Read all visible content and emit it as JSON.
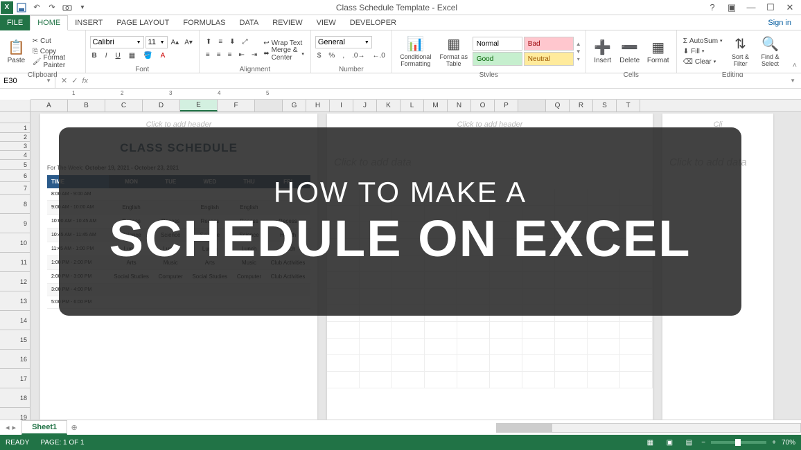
{
  "window": {
    "title": "Class Schedule Template - Excel",
    "help": "?",
    "signin": "Sign in"
  },
  "tabs": {
    "file": "FILE",
    "home": "HOME",
    "insert": "INSERT",
    "page_layout": "PAGE LAYOUT",
    "formulas": "FORMULAS",
    "data": "DATA",
    "review": "REVIEW",
    "view": "VIEW",
    "developer": "DEVELOPER"
  },
  "ribbon": {
    "clipboard": {
      "paste": "Paste",
      "cut": "Cut",
      "copy": "Copy",
      "painter": "Format Painter",
      "label": "Clipboard"
    },
    "font": {
      "name": "Calibri",
      "size": "11",
      "label": "Font"
    },
    "alignment": {
      "wrap": "Wrap Text",
      "merge": "Merge & Center",
      "label": "Alignment"
    },
    "number": {
      "format": "General",
      "label": "Number"
    },
    "styles": {
      "cond": "Conditional Formatting",
      "table": "Format as Table",
      "normal": "Normal",
      "bad": "Bad",
      "good": "Good",
      "neutral": "Neutral",
      "label": "Styles"
    },
    "cells": {
      "insert": "Insert",
      "delete": "Delete",
      "format": "Format",
      "label": "Cells"
    },
    "editing": {
      "autosum": "AutoSum",
      "fill": "Fill",
      "clear": "Clear",
      "sort": "Sort & Filter",
      "find": "Find & Select",
      "label": "Editing"
    }
  },
  "namebox": "E30",
  "columns": [
    "A",
    "B",
    "C",
    "D",
    "E",
    "F",
    "",
    "G",
    "H",
    "I",
    "J",
    "K",
    "L",
    "M",
    "N",
    "O",
    "P",
    "",
    "Q",
    "R",
    "S",
    "T"
  ],
  "rows": [
    "1",
    "2",
    "3",
    "4",
    "5",
    "6",
    "7",
    "8",
    "9",
    "10",
    "11",
    "12",
    "13",
    "14",
    "15",
    "16",
    "17",
    "18",
    "19"
  ],
  "ruler_marks": [
    "1",
    "2",
    "3",
    "4",
    "5"
  ],
  "schedule": {
    "title": "CLASS SCHEDULE",
    "week_label": "For The Week:",
    "week_value": "October 19, 2021 - October 23, 2021",
    "headers": [
      "TIME",
      "MON",
      "TUE",
      "WED",
      "THU",
      "FRI"
    ],
    "rows": [
      [
        "8:00 AM - 9:00 AM",
        "",
        "",
        "",
        "",
        ""
      ],
      [
        "9:00 AM - 10:00 AM",
        "English",
        "",
        "English",
        "English",
        ""
      ],
      [
        "10:00 AM - 10:45 AM",
        "Recess",
        "Recess",
        "Recess",
        "Recess",
        "Recess"
      ],
      [
        "10:45 AM - 11:45 AM",
        "Science",
        "Science",
        "Science",
        "Science",
        "Health"
      ],
      [
        "11:45 AM - 1:00 PM",
        "Lunch",
        "Lunch",
        "Lunch",
        "Lunch",
        "Lunch"
      ],
      [
        "1:00 PM - 2:00 PM",
        "Arts",
        "Music",
        "Arts",
        "Music",
        "Club Activities"
      ],
      [
        "2:00 PM - 3:00 PM",
        "Social Studies",
        "Computer",
        "Social Studies",
        "Computer",
        "Club Activities"
      ],
      [
        "3:00 PM - 4:00 PM",
        "",
        "",
        "",
        "",
        ""
      ],
      [
        "5:00 PM - 6:00 PM",
        "",
        "",
        "",
        "",
        ""
      ]
    ]
  },
  "placeholders": {
    "header": "Click to add header",
    "data": "Click to add data"
  },
  "sheettabs": {
    "name": "Sheet1"
  },
  "statusbar": {
    "ready": "READY",
    "page": "PAGE: 1 OF 1",
    "zoom": "70%"
  },
  "overlay": {
    "line1": "HOW TO MAKE A",
    "line2": "SCHEDULE ON EXCEL"
  }
}
